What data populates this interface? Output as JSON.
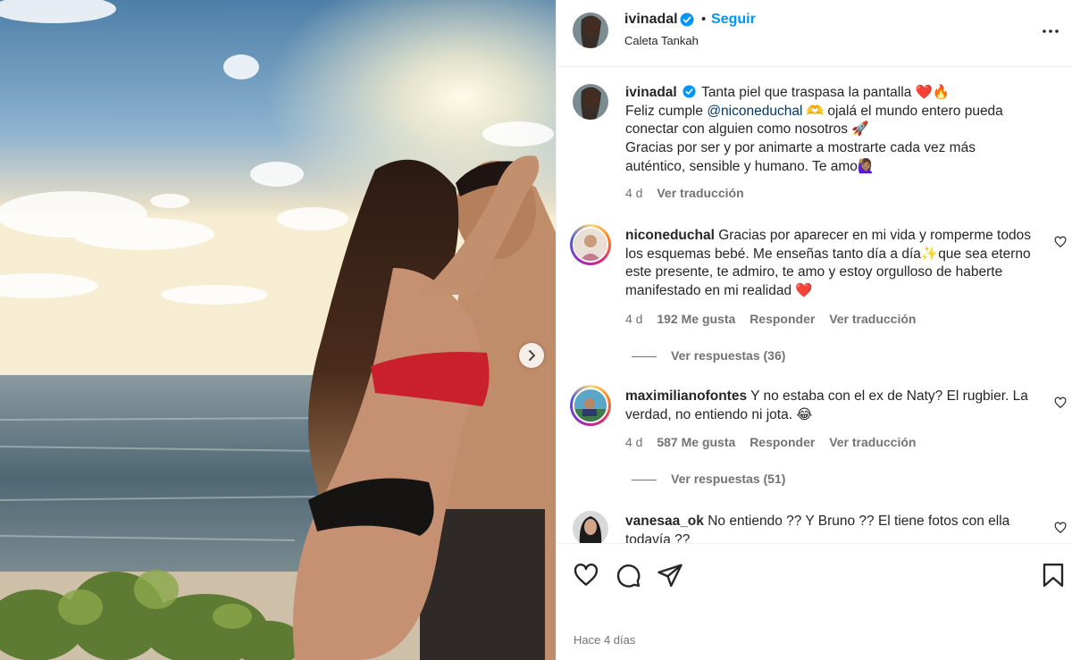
{
  "post": {
    "username": "ivinadal",
    "follow_label": "Seguir",
    "separator": "•",
    "location": "Caleta Tankah",
    "time_ago": "Hace 4 días"
  },
  "caption": {
    "username": "ivinadal",
    "line1": "Tanta piel que traspasa la pantalla ❤️🔥",
    "line2_prefix": "Feliz cumple ",
    "mention": "@niconeduchal",
    "line2_rest": " 🫶 ojalá el mundo entero pueda conectar con alguien como nosotros 🚀",
    "line3": "Gracias por ser y por animarte a mostrarte cada vez más auténtico, sensible y humano. Te amo🙋🏽‍♀️",
    "age": "4 d",
    "translate": "Ver traducción"
  },
  "comments": [
    {
      "username": "niconeduchal",
      "text": "Gracias por aparecer en mi vida y romperme todos los esquemas bebé. Me enseñas tanto día a día✨que sea eterno este presente, te admiro, te amo y estoy orgulloso de haberte manifestado en mi realidad ❤️",
      "age": "4 d",
      "likes": "192 Me gusta",
      "reply": "Responder",
      "translate": "Ver traducción",
      "view_replies": "Ver respuestas (36)"
    },
    {
      "username": "maximilianofontes",
      "text": "Y no estaba con el ex de Naty? El rugbier. La verdad, no entiendo ni jota. 😂",
      "age": "4 d",
      "likes": "587 Me gusta",
      "reply": "Responder",
      "translate": "Ver traducción",
      "view_replies": "Ver respuestas (51)"
    },
    {
      "username": "vanesaa_ok",
      "text": "No entiendo ?? Y Bruno ?? El tiene fotos con ella todavía ??"
    }
  ],
  "icons": {
    "verified": "verified-badge-icon",
    "more": "more-options-icon",
    "next": "chevron-right-icon",
    "like": "heart-icon",
    "comment": "comment-icon",
    "share": "send-icon",
    "save": "bookmark-icon"
  },
  "colors": {
    "link": "#0095f6",
    "mention": "#00376b",
    "muted": "#737373",
    "verified": "#0095f6"
  }
}
